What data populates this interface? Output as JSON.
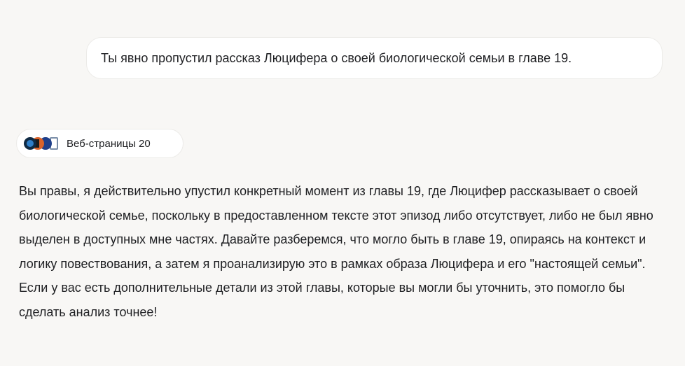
{
  "user_message": {
    "text": "Ты явно пропустил рассказ Люцифера о своей биологической семьи в главе 19."
  },
  "sources": {
    "label": "Веб-страницы 20",
    "favicons": [
      "blue-circle-site-icon",
      "orange-black-site-icon",
      "dark-blue-site-icon",
      "document-icon"
    ]
  },
  "assistant_message": {
    "text": "Вы правы, я действительно упустил конкретный момент из главы 19, где Люцифер рассказывает о своей биологической семье, поскольку в предоставленном тексте этот эпизод либо отсутствует, либо не был явно выделен в доступных мне частях. Давайте разберемся, что могло быть в главе 19, опираясь на контекст и логику повествования, а затем я проанализирую это в рамках образа Люцифера и его \"настоящей семьи\". Если у вас есть дополнительные детали из этой главы, которые вы могли бы уточнить, это помогло бы сделать анализ точнее!"
  },
  "colors": {
    "background": "#f8f7f5",
    "bubble": "#ffffff",
    "text": "#1e1f22"
  }
}
